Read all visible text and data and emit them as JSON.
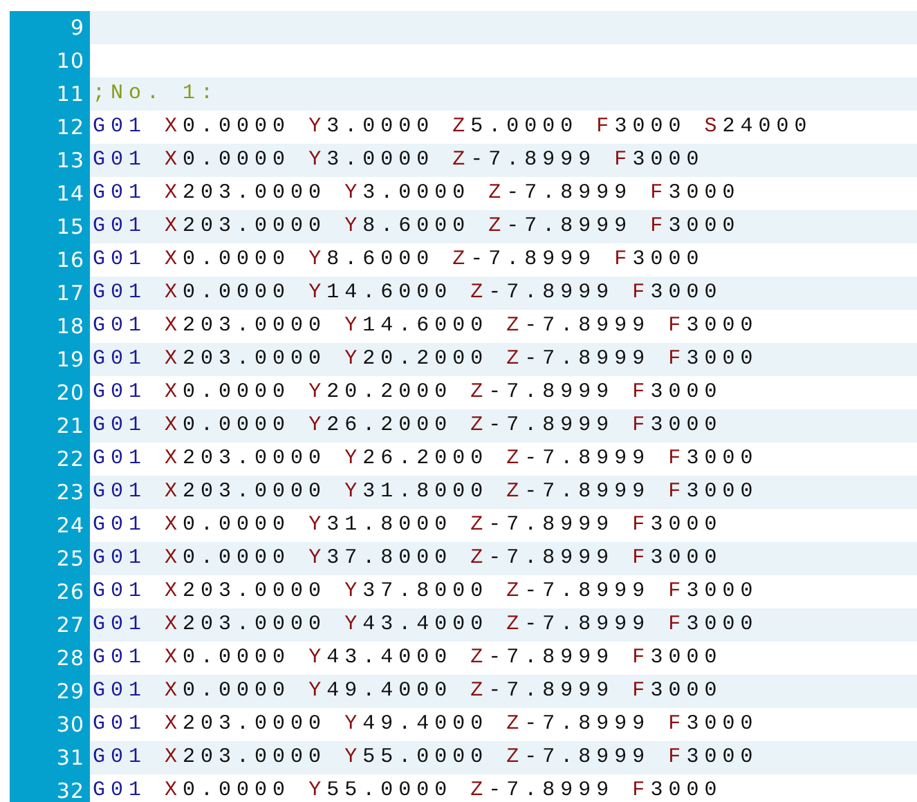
{
  "lines": [
    {
      "number": "9"
    },
    {
      "number": "10"
    },
    {
      "number": "11",
      "words": [
        {
          "kind": "comment",
          "text": ";No. 1:"
        }
      ]
    },
    {
      "number": "12",
      "words": [
        {
          "kind": "command",
          "text": "G01"
        },
        {
          "kind": "address",
          "letter": "X",
          "value": "0.0000"
        },
        {
          "kind": "address",
          "letter": "Y",
          "value": "3.0000"
        },
        {
          "kind": "address",
          "letter": "Z",
          "value": "5.0000"
        },
        {
          "kind": "address",
          "letter": "F",
          "value": "3000"
        },
        {
          "kind": "address",
          "letter": "S",
          "value": "24000"
        }
      ]
    },
    {
      "number": "13",
      "words": [
        {
          "kind": "command",
          "text": "G01"
        },
        {
          "kind": "address",
          "letter": "X",
          "value": "0.0000"
        },
        {
          "kind": "address",
          "letter": "Y",
          "value": "3.0000"
        },
        {
          "kind": "address",
          "letter": "Z",
          "value": "-7.8999"
        },
        {
          "kind": "address",
          "letter": "F",
          "value": "3000"
        }
      ]
    },
    {
      "number": "14",
      "words": [
        {
          "kind": "command",
          "text": "G01"
        },
        {
          "kind": "address",
          "letter": "X",
          "value": "203.0000"
        },
        {
          "kind": "address",
          "letter": "Y",
          "value": "3.0000"
        },
        {
          "kind": "address",
          "letter": "Z",
          "value": "-7.8999"
        },
        {
          "kind": "address",
          "letter": "F",
          "value": "3000"
        }
      ]
    },
    {
      "number": "15",
      "words": [
        {
          "kind": "command",
          "text": "G01"
        },
        {
          "kind": "address",
          "letter": "X",
          "value": "203.0000"
        },
        {
          "kind": "address",
          "letter": "Y",
          "value": "8.6000"
        },
        {
          "kind": "address",
          "letter": "Z",
          "value": "-7.8999"
        },
        {
          "kind": "address",
          "letter": "F",
          "value": "3000"
        }
      ]
    },
    {
      "number": "16",
      "words": [
        {
          "kind": "command",
          "text": "G01"
        },
        {
          "kind": "address",
          "letter": "X",
          "value": "0.0000"
        },
        {
          "kind": "address",
          "letter": "Y",
          "value": "8.6000"
        },
        {
          "kind": "address",
          "letter": "Z",
          "value": "-7.8999"
        },
        {
          "kind": "address",
          "letter": "F",
          "value": "3000"
        }
      ]
    },
    {
      "number": "17",
      "words": [
        {
          "kind": "command",
          "text": "G01"
        },
        {
          "kind": "address",
          "letter": "X",
          "value": "0.0000"
        },
        {
          "kind": "address",
          "letter": "Y",
          "value": "14.6000"
        },
        {
          "kind": "address",
          "letter": "Z",
          "value": "-7.8999"
        },
        {
          "kind": "address",
          "letter": "F",
          "value": "3000"
        }
      ]
    },
    {
      "number": "18",
      "words": [
        {
          "kind": "command",
          "text": "G01"
        },
        {
          "kind": "address",
          "letter": "X",
          "value": "203.0000"
        },
        {
          "kind": "address",
          "letter": "Y",
          "value": "14.6000"
        },
        {
          "kind": "address",
          "letter": "Z",
          "value": "-7.8999"
        },
        {
          "kind": "address",
          "letter": "F",
          "value": "3000"
        }
      ]
    },
    {
      "number": "19",
      "words": [
        {
          "kind": "command",
          "text": "G01"
        },
        {
          "kind": "address",
          "letter": "X",
          "value": "203.0000"
        },
        {
          "kind": "address",
          "letter": "Y",
          "value": "20.2000"
        },
        {
          "kind": "address",
          "letter": "Z",
          "value": "-7.8999"
        },
        {
          "kind": "address",
          "letter": "F",
          "value": "3000"
        }
      ]
    },
    {
      "number": "20",
      "words": [
        {
          "kind": "command",
          "text": "G01"
        },
        {
          "kind": "address",
          "letter": "X",
          "value": "0.0000"
        },
        {
          "kind": "address",
          "letter": "Y",
          "value": "20.2000"
        },
        {
          "kind": "address",
          "letter": "Z",
          "value": "-7.8999"
        },
        {
          "kind": "address",
          "letter": "F",
          "value": "3000"
        }
      ]
    },
    {
      "number": "21",
      "words": [
        {
          "kind": "command",
          "text": "G01"
        },
        {
          "kind": "address",
          "letter": "X",
          "value": "0.0000"
        },
        {
          "kind": "address",
          "letter": "Y",
          "value": "26.2000"
        },
        {
          "kind": "address",
          "letter": "Z",
          "value": "-7.8999"
        },
        {
          "kind": "address",
          "letter": "F",
          "value": "3000"
        }
      ]
    },
    {
      "number": "22",
      "words": [
        {
          "kind": "command",
          "text": "G01"
        },
        {
          "kind": "address",
          "letter": "X",
          "value": "203.0000"
        },
        {
          "kind": "address",
          "letter": "Y",
          "value": "26.2000"
        },
        {
          "kind": "address",
          "letter": "Z",
          "value": "-7.8999"
        },
        {
          "kind": "address",
          "letter": "F",
          "value": "3000"
        }
      ]
    },
    {
      "number": "23",
      "words": [
        {
          "kind": "command",
          "text": "G01"
        },
        {
          "kind": "address",
          "letter": "X",
          "value": "203.0000"
        },
        {
          "kind": "address",
          "letter": "Y",
          "value": "31.8000"
        },
        {
          "kind": "address",
          "letter": "Z",
          "value": "-7.8999"
        },
        {
          "kind": "address",
          "letter": "F",
          "value": "3000"
        }
      ]
    },
    {
      "number": "24",
      "words": [
        {
          "kind": "command",
          "text": "G01"
        },
        {
          "kind": "address",
          "letter": "X",
          "value": "0.0000"
        },
        {
          "kind": "address",
          "letter": "Y",
          "value": "31.8000"
        },
        {
          "kind": "address",
          "letter": "Z",
          "value": "-7.8999"
        },
        {
          "kind": "address",
          "letter": "F",
          "value": "3000"
        }
      ]
    },
    {
      "number": "25",
      "words": [
        {
          "kind": "command",
          "text": "G01"
        },
        {
          "kind": "address",
          "letter": "X",
          "value": "0.0000"
        },
        {
          "kind": "address",
          "letter": "Y",
          "value": "37.8000"
        },
        {
          "kind": "address",
          "letter": "Z",
          "value": "-7.8999"
        },
        {
          "kind": "address",
          "letter": "F",
          "value": "3000"
        }
      ]
    },
    {
      "number": "26",
      "words": [
        {
          "kind": "command",
          "text": "G01"
        },
        {
          "kind": "address",
          "letter": "X",
          "value": "203.0000"
        },
        {
          "kind": "address",
          "letter": "Y",
          "value": "37.8000"
        },
        {
          "kind": "address",
          "letter": "Z",
          "value": "-7.8999"
        },
        {
          "kind": "address",
          "letter": "F",
          "value": "3000"
        }
      ]
    },
    {
      "number": "27",
      "words": [
        {
          "kind": "command",
          "text": "G01"
        },
        {
          "kind": "address",
          "letter": "X",
          "value": "203.0000"
        },
        {
          "kind": "address",
          "letter": "Y",
          "value": "43.4000"
        },
        {
          "kind": "address",
          "letter": "Z",
          "value": "-7.8999"
        },
        {
          "kind": "address",
          "letter": "F",
          "value": "3000"
        }
      ]
    },
    {
      "number": "28",
      "words": [
        {
          "kind": "command",
          "text": "G01"
        },
        {
          "kind": "address",
          "letter": "X",
          "value": "0.0000"
        },
        {
          "kind": "address",
          "letter": "Y",
          "value": "43.4000"
        },
        {
          "kind": "address",
          "letter": "Z",
          "value": "-7.8999"
        },
        {
          "kind": "address",
          "letter": "F",
          "value": "3000"
        }
      ]
    },
    {
      "number": "29",
      "words": [
        {
          "kind": "command",
          "text": "G01"
        },
        {
          "kind": "address",
          "letter": "X",
          "value": "0.0000"
        },
        {
          "kind": "address",
          "letter": "Y",
          "value": "49.4000"
        },
        {
          "kind": "address",
          "letter": "Z",
          "value": "-7.8999"
        },
        {
          "kind": "address",
          "letter": "F",
          "value": "3000"
        }
      ]
    },
    {
      "number": "30",
      "words": [
        {
          "kind": "command",
          "text": "G01"
        },
        {
          "kind": "address",
          "letter": "X",
          "value": "203.0000"
        },
        {
          "kind": "address",
          "letter": "Y",
          "value": "49.4000"
        },
        {
          "kind": "address",
          "letter": "Z",
          "value": "-7.8999"
        },
        {
          "kind": "address",
          "letter": "F",
          "value": "3000"
        }
      ]
    },
    {
      "number": "31",
      "words": [
        {
          "kind": "command",
          "text": "G01"
        },
        {
          "kind": "address",
          "letter": "X",
          "value": "203.0000"
        },
        {
          "kind": "address",
          "letter": "Y",
          "value": "55.0000"
        },
        {
          "kind": "address",
          "letter": "Z",
          "value": "-7.8999"
        },
        {
          "kind": "address",
          "letter": "F",
          "value": "3000"
        }
      ]
    },
    {
      "number": "32",
      "words": [
        {
          "kind": "command",
          "text": "G01"
        },
        {
          "kind": "address",
          "letter": "X",
          "value": "0.0000"
        },
        {
          "kind": "address",
          "letter": "Y",
          "value": "55.0000"
        },
        {
          "kind": "address",
          "letter": "Z",
          "value": "-7.8999"
        },
        {
          "kind": "address",
          "letter": "F",
          "value": "3000"
        }
      ]
    }
  ]
}
